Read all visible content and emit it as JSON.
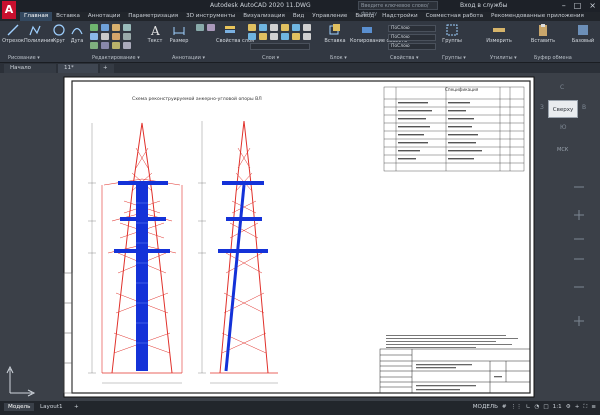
{
  "app": {
    "logo_letter": "A",
    "window_title": "Autodesk AutoCAD 2020   11.DWG",
    "search_placeholder": "Введите ключевое слово/фразу",
    "signin_label": "Вход в службы"
  },
  "ribbon_tabs": [
    {
      "label": "Главная",
      "active": true
    },
    {
      "label": "Вставка",
      "active": false
    },
    {
      "label": "Аннотации",
      "active": false
    },
    {
      "label": "Параметризация",
      "active": false
    },
    {
      "label": "3D инструменты",
      "active": false
    },
    {
      "label": "Визуализация",
      "active": false
    },
    {
      "label": "Вид",
      "active": false
    },
    {
      "label": "Управление",
      "active": false
    },
    {
      "label": "Вывод",
      "active": false
    },
    {
      "label": "Надстройки",
      "active": false
    },
    {
      "label": "Совместная работа",
      "active": false
    },
    {
      "label": "Рекомендованные приложения",
      "active": false
    }
  ],
  "ribbon": {
    "tools": {
      "otrezok": "Отрезок",
      "polyline": "Полилиния",
      "circle": "Круг",
      "arc": "Дуга",
      "text": "Текст",
      "dimension": "Размер",
      "layer_props": "Свойства слоя",
      "insert": "Вставка",
      "copy_props": "Копирование свойств",
      "groups": "Группы",
      "measure": "Измерить",
      "paste": "Вставить",
      "base": "Базовый"
    },
    "panels": {
      "draw": "Рисование ▾",
      "modify": "Редактирование ▾",
      "annotation": "Аннотации ▾",
      "layers": "Слои ▾",
      "block": "Блок ▾",
      "properties": "Свойства ▾",
      "groups": "Группы ▾",
      "utilities": "Утилиты ▾",
      "clipboard": "Буфер обмена"
    },
    "combos": {
      "color": "ПоСлою",
      "linetype": "ПоСлою",
      "lineweight": "ПоСлою"
    }
  },
  "document_tabs": {
    "start": "Начало",
    "file": "11*",
    "add": "+"
  },
  "drawing": {
    "sheet_title": "Схема реконструируемой анкерно-угловой опоры ВЛ",
    "spec_header": "Спецификация"
  },
  "viewcube": {
    "face": "Сверху",
    "north": "С",
    "south": "Ю",
    "west": "З",
    "east": "В",
    "wcs": "МСК"
  },
  "layout_tabs": [
    {
      "label": "Модель",
      "active": true
    },
    {
      "label": "Layout1",
      "active": false
    },
    {
      "label": "+",
      "active": false
    }
  ],
  "status": {
    "mode": "МОДЕЛЬ",
    "scale": "1:1"
  },
  "colors": {
    "tower_red": "#e0302a",
    "tower_blue": "#1432d8",
    "sheet_bg": "#ffffff",
    "ribbon_bg": "#323842"
  }
}
